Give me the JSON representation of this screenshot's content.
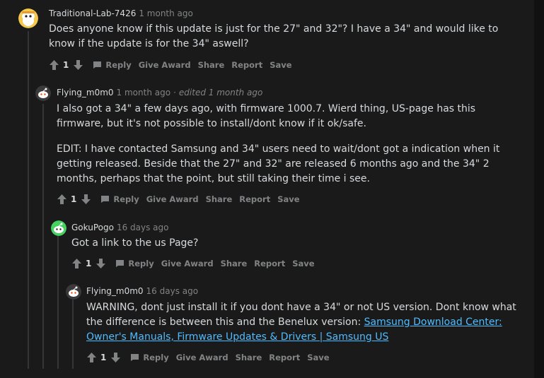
{
  "colors": {
    "bg": "#1a1a1b",
    "text": "#d7dadc",
    "meta": "#818384",
    "link": "#4fbcff",
    "thread": "#343536"
  },
  "comments": [
    {
      "user": "Traditional-Lab-7426",
      "time": "1 month ago",
      "paragraphs": [
        "Does anyone know if this update is just for the 27\" and 32\"? I have a 34\" and would like to know if the update is for the 34\" aswell?"
      ],
      "score": "1"
    },
    {
      "user": "Flying_m0m0",
      "time": "1 month ago",
      "edited": "edited 1 month ago",
      "paragraphs": [
        "I also got a 34\" a few days ago, with firmware 1000.7. Wierd thing, US-page has this firmware, but it's not possible to install/dont know if it ok/safe.",
        "EDIT: I have contacted Samsung and 34\" users need to wait/dont got a indication when it getting released. Beside that the 27\" and 32\" are released 6 months ago and the 34\" 2 months, perhaps that the point, but still taking their time i see."
      ],
      "score": "1"
    },
    {
      "user": "GokuPogo",
      "time": "16 days ago",
      "paragraphs": [
        "Got a link to the us Page?"
      ],
      "score": "1"
    },
    {
      "user": "Flying_m0m0",
      "time": "16 days ago",
      "text_before_link": "WARNING, dont just install it if you dont have a 34\" or not US version. Dont know what the difference is between this and the Benelux version: ",
      "link_text": "Samsung Download Center: Owner's Manuals, Firmware Updates & Drivers | Samsung US",
      "score": "1"
    }
  ],
  "actions": {
    "reply": "Reply",
    "give_award": "Give Award",
    "share": "Share",
    "report": "Report",
    "save": "Save"
  },
  "edited_separator": "·"
}
